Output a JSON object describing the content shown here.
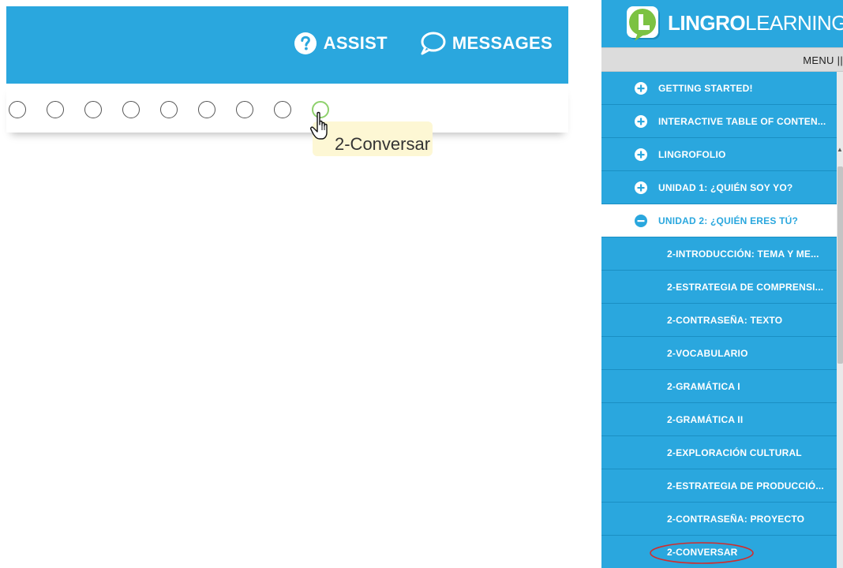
{
  "header": {
    "assist_label": "ASSIST",
    "messages_label": "MESSAGES"
  },
  "progress": {
    "total_dots": 9,
    "active_index": 8,
    "tooltip": "2-Conversar"
  },
  "brand": {
    "name_bold": "LINGRO",
    "name_light": "LEARNING"
  },
  "menu": {
    "label": "MENU ||"
  },
  "nav": {
    "items": [
      {
        "label": "GETTING STARTED!"
      },
      {
        "label": "INTERACTIVE TABLE OF CONTEN..."
      },
      {
        "label": "LINGROFOLIO"
      },
      {
        "label": "UNIDAD 1: ¿QUIÉN SOY YO?"
      },
      {
        "label": "UNIDAD 2: ¿QUIÉN ERES TÚ?"
      }
    ],
    "sub_items": [
      {
        "label": "2-INTRODUCCIÓN: TEMA Y ME..."
      },
      {
        "label": "2-ESTRATEGIA DE COMPRENSI..."
      },
      {
        "label": "2-CONTRASEÑA: TEXTO"
      },
      {
        "label": "2-VOCABULARIO"
      },
      {
        "label": "2-GRAMÁTICA I"
      },
      {
        "label": "2-GRAMÁTICA II"
      },
      {
        "label": "2-EXPLORACIÓN CULTURAL"
      },
      {
        "label": "2-ESTRATEGIA DE PRODUCCIÓ..."
      },
      {
        "label": "2-CONTRASEÑA: PROYECTO"
      },
      {
        "label": "2-CONVERSAR"
      }
    ]
  },
  "colors": {
    "brand_blue": "#2aa7de",
    "active_dot": "#8ed16c",
    "tooltip_bg": "#fdf7d4",
    "highlight_ellipse": "#d22c2c",
    "logo_green": "#7cc242"
  }
}
